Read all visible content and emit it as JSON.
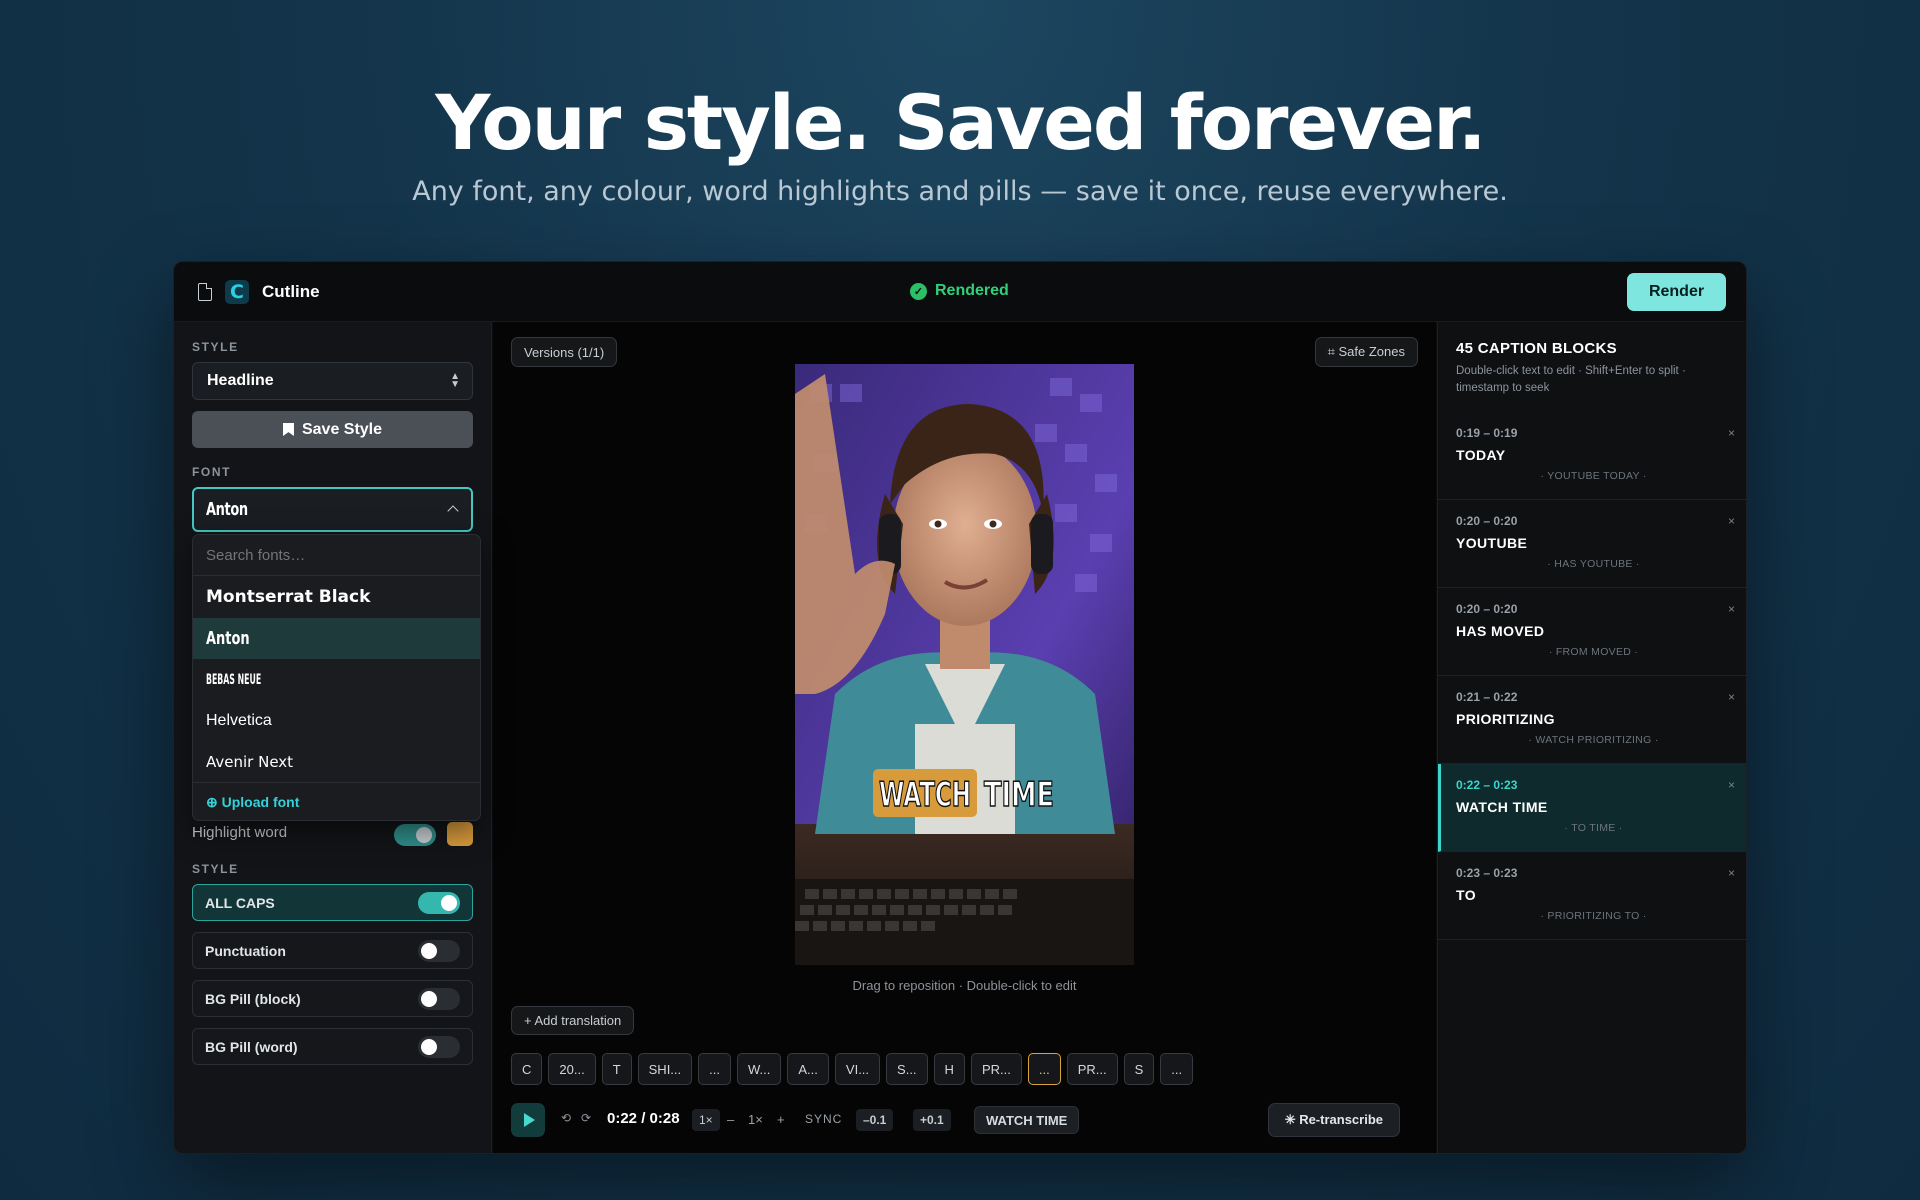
{
  "hero": {
    "title": "Your style. Saved forever.",
    "subtitle": "Any font, any colour, word highlights and pills — save it once, reuse everywhere."
  },
  "topbar": {
    "app_name": "Cutline",
    "logo_letter": "C",
    "status": "Rendered",
    "status_check": "✓",
    "render_label": "Render"
  },
  "sidebar": {
    "style_label": "STYLE",
    "style_value": "Headline",
    "save_style_label": "Save Style",
    "font_label": "FONT",
    "font_value": "Anton",
    "font_search_placeholder": "Search fonts…",
    "font_options": [
      "Montserrat Black",
      "Anton",
      "BEBAS NEUE",
      "Helvetica",
      "Avenir Next"
    ],
    "upload_font_label": "⊕ Upload font",
    "highlight_label": "Highlight word",
    "highlight_color": "#d89b3c",
    "style2_label": "STYLE",
    "options": [
      {
        "label": "ALL CAPS",
        "on": true
      },
      {
        "label": "Punctuation",
        "on": false
      },
      {
        "label": "BG Pill (block)",
        "on": false
      },
      {
        "label": "BG Pill (word)",
        "on": false
      }
    ]
  },
  "center": {
    "versions_label": "Versions (1/1)",
    "safe_zones_label": "⌗ Safe Zones",
    "caption_highlight": "WATCH",
    "caption_rest": "TIME",
    "drag_hint": "Drag to reposition  ·  Double-click to edit",
    "add_translation_label": "+ Add translation",
    "chips": [
      "C",
      "20...",
      "T",
      "SHI...",
      "...",
      "W...",
      "A...",
      "VI...",
      "S...",
      "H",
      "PR...",
      "...",
      "PR...",
      "S",
      "..."
    ],
    "selected_chip": 11,
    "transport": {
      "rewind_icon": "⟲",
      "forward_icon": "⟳",
      "time": "0:22 / 0:28",
      "speed_badge": "1×",
      "minus": "–",
      "speed": "1×",
      "plus": "+",
      "sync_label": "SYNC",
      "sync_minus": "–0.1",
      "sync_plus": "+0.1",
      "current_caption": "WATCH TIME",
      "retranscribe_label": "✳ Re-transcribe"
    }
  },
  "right": {
    "title": "45 CAPTION BLOCKS",
    "help": "Double-click text to edit · Shift+Enter to split · timestamp to seek",
    "blocks": [
      {
        "time": "0:19 – 0:19",
        "text": "TODAY",
        "context": "· YOUTUBE TODAY ·"
      },
      {
        "time": "0:20 – 0:20",
        "text": "YOUTUBE",
        "context": "· HAS YOUTUBE ·"
      },
      {
        "time": "0:20 – 0:20",
        "text": "HAS MOVED",
        "context": "· FROM MOVED ·"
      },
      {
        "time": "0:21 – 0:22",
        "text": "PRIORITIZING",
        "context": "· WATCH PRIORITIZING ·"
      },
      {
        "time": "0:22 – 0:23",
        "text": "WATCH TIME",
        "context": "· TO TIME ·"
      },
      {
        "time": "0:23 – 0:23",
        "text": "TO",
        "context": "· PRIORITIZING TO ·"
      }
    ],
    "active_block": 4,
    "close_glyph": "×"
  },
  "colors": {
    "accent": "#46c7c0",
    "render": "#7ee6df",
    "rendered_status": "#31d07a",
    "highlight": "#d89b3c"
  }
}
